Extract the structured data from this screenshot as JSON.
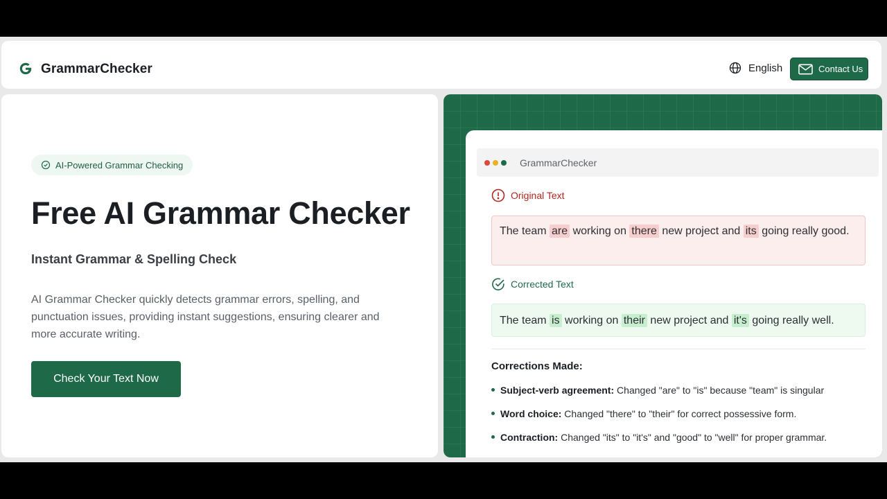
{
  "header": {
    "brand": "GrammarChecker",
    "language": "English",
    "contact_label": "Contact Us"
  },
  "hero": {
    "badge": "AI-Powered Grammar Checking",
    "title": "Free AI Grammar Checker",
    "subtitle": "Instant Grammar & Spelling Check",
    "description": "AI Grammar Checker quickly detects grammar errors, spelling, and punctuation issues, providing instant suggestions, ensuring clearer and more accurate writing.",
    "cta_label": "Check Your Text Now"
  },
  "demo": {
    "window_title": "GrammarChecker",
    "original_label": "Original Text",
    "corrected_label": "Corrected Text",
    "original": {
      "t1": "The team ",
      "e1": "are",
      "t2": " working on ",
      "e2": "there",
      "t3": " new project and ",
      "e3": "its",
      "t4": " going really good."
    },
    "corrected": {
      "t1": "The team ",
      "c1": "is",
      "t2": " working on ",
      "c2": "their",
      "t3": " new project and ",
      "c3": "it's",
      "t4": " going really well."
    },
    "corrections_heading": "Corrections Made:",
    "corrections": [
      {
        "title": "Subject-verb agreement:",
        "text": " Changed \"are\" to \"is\" because \"team\" is singular"
      },
      {
        "title": "Word choice:",
        "text": " Changed \"there\" to \"their\" for correct possessive form."
      },
      {
        "title": "Contraction:",
        "text": " Changed \"its\" to \"it's\" and \"good\" to \"well\" for proper grammar."
      }
    ]
  },
  "colors": {
    "brand_green": "#1e6a48",
    "error_red": "#b3261e",
    "dot_red": "#e0463c",
    "dot_yellow": "#e6b323",
    "dot_green": "#1e6a48"
  },
  "icons": [
    "g-logo-icon",
    "globe-icon",
    "mail-icon",
    "check-circle-icon",
    "alert-circle-icon"
  ]
}
